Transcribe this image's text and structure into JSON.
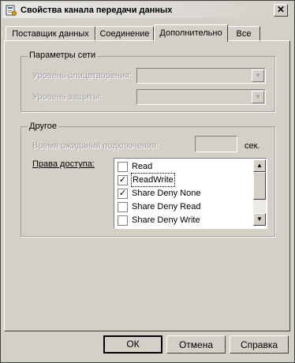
{
  "window": {
    "title": "Свойства канала передачи данных",
    "close_glyph": "✕"
  },
  "tabs": [
    {
      "label": "Поставщик данных",
      "active": false
    },
    {
      "label": "Соединение",
      "active": false
    },
    {
      "label": "Дополнительно",
      "active": true
    },
    {
      "label": "Все",
      "active": false
    }
  ],
  "network_group": {
    "title": "Параметры сети",
    "impersonation_label": "Уровень олицетворения:",
    "protection_label": "Уровень защиты:"
  },
  "other_group": {
    "title": "Другое",
    "timeout_label": "Время ожидания подключения:",
    "timeout_value": "",
    "timeout_unit": "сек.",
    "access_label": "Права доступа:",
    "access_items": [
      {
        "label": "Read",
        "checked": false
      },
      {
        "label": "ReadWrite",
        "checked": true
      },
      {
        "label": "Share Deny None",
        "checked": true
      },
      {
        "label": "Share Deny Read",
        "checked": false
      },
      {
        "label": "Share Deny Write",
        "checked": false
      }
    ]
  },
  "buttons": {
    "ok": "ОК",
    "cancel": "Отмена",
    "help": "Справка"
  }
}
